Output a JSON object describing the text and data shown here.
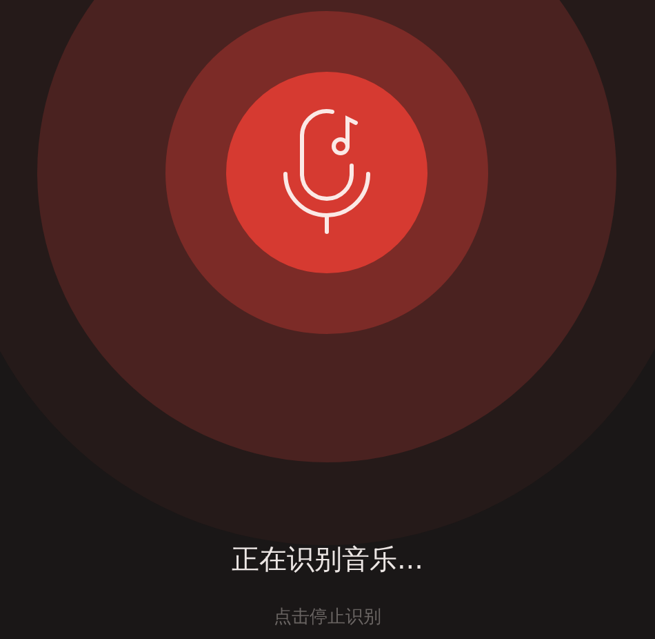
{
  "status": {
    "title": "正在识别音乐..."
  },
  "stop_button": {
    "label": "点击停止识别"
  }
}
